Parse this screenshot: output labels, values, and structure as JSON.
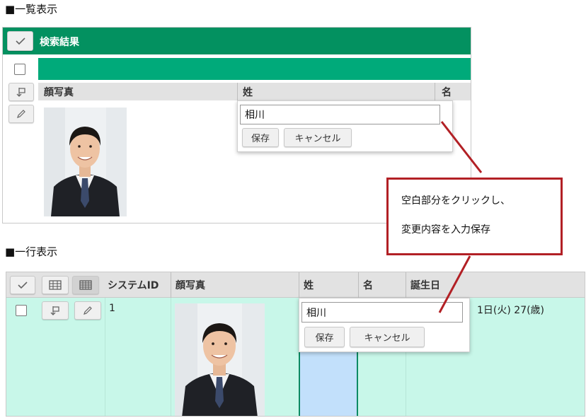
{
  "list_view": {
    "section_label": "■一覧表示",
    "panel_title": "検索結果",
    "columns": [
      "顔写真",
      "姓",
      "名"
    ],
    "edit_popup": {
      "value": "相川",
      "save_label": "保存",
      "cancel_label": "キャンセル"
    }
  },
  "row_view": {
    "section_label": "■一行表示",
    "columns": [
      "システムID",
      "顔写真",
      "姓",
      "名",
      "誕生日"
    ],
    "row": {
      "system_id": "1",
      "birthday_partial": "1日(火) 27(歳)"
    },
    "edit_popup": {
      "value": "相川",
      "save_label": "保存",
      "cancel_label": "キャンセル"
    }
  },
  "callout": {
    "line1": "空白部分をクリックし、",
    "line2": "変更内容を入力保存"
  },
  "colors": {
    "header_green": "#039160",
    "band_green": "#00aa7a",
    "row_mint": "#c8f7e9",
    "callout_red": "#b22025",
    "selected_blue": "#c2e0fb"
  }
}
